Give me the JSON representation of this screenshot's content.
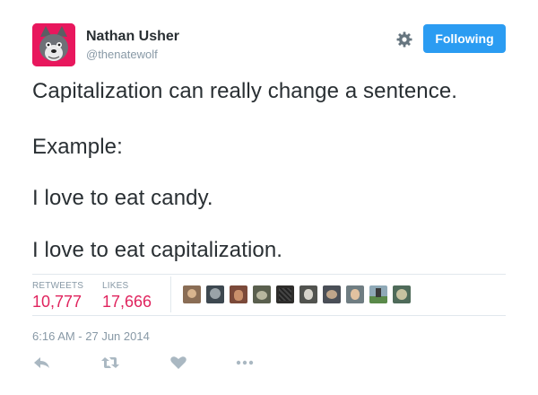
{
  "user": {
    "name": "Nathan Usher",
    "handle": "@thenatewolf"
  },
  "follow_button": {
    "label": "Following"
  },
  "tweet": {
    "lines": [
      "Capitalization can really change a sentence.",
      "Example:",
      "I love to eat candy.",
      "I love to eat capitalization."
    ]
  },
  "stats": {
    "retweets_label": "RETWEETS",
    "retweets_value": "10,777",
    "likes_label": "LIKES",
    "likes_value": "17,666"
  },
  "timestamp": "6:16 AM - 27 Jun 2014",
  "colors": {
    "accent": "#2b9cf2",
    "stat_value": "#e0245e",
    "avatar_bg": "#e8175d"
  },
  "icons": [
    "gear-icon",
    "reply-icon",
    "retweet-icon",
    "like-icon",
    "more-icon"
  ]
}
